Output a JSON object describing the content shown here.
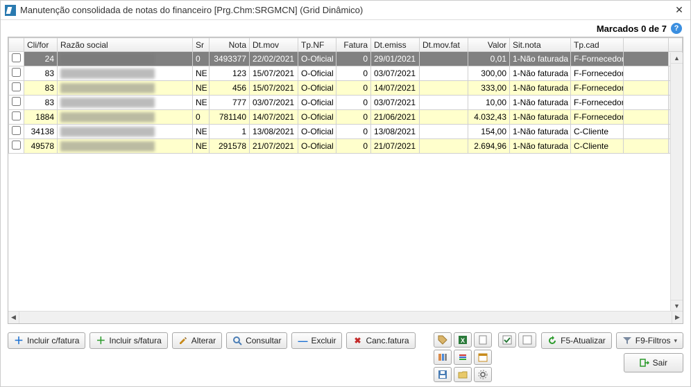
{
  "window": {
    "title": "Manutenção consolidada de notas do financeiro [Prg.Chm:SRGMCN] (Grid Dinâmico)"
  },
  "header": {
    "marcados_label": "Marcados 0 de 7"
  },
  "columns": {
    "chk": "",
    "clifor": "Cli/for",
    "razao": "Razão social",
    "sr": "Sr",
    "nota": "Nota",
    "dtmov": "Dt.mov",
    "tpnf": "Tp.NF",
    "fatura": "Fatura",
    "dtemiss": "Dt.emiss",
    "dtmovfat": "Dt.mov.fat",
    "valor": "Valor",
    "sitnota": "Sit.nota",
    "tpcad": "Tp.cad"
  },
  "rows": [
    {
      "clifor": "24",
      "razao": "████████████████",
      "sr": "0",
      "nota": "3493377",
      "dtmov": "22/02/2021",
      "tpnf": "O-Oficial",
      "fatura": "0",
      "dtemiss": "29/01/2021",
      "dtmovfat": "",
      "valor": "0,01",
      "sitnota": "1-Não faturada",
      "tpcad": "F-Fornecedor",
      "style": "sel"
    },
    {
      "clifor": "83",
      "razao": "████████████████",
      "sr": "NE",
      "nota": "123",
      "dtmov": "15/07/2021",
      "tpnf": "O-Oficial",
      "fatura": "0",
      "dtemiss": "03/07/2021",
      "dtmovfat": "",
      "valor": "300,00",
      "sitnota": "1-Não faturada",
      "tpcad": "F-Fornecedor",
      "style": "nor"
    },
    {
      "clifor": "83",
      "razao": "████████████████",
      "sr": "NE",
      "nota": "456",
      "dtmov": "15/07/2021",
      "tpnf": "O-Oficial",
      "fatura": "0",
      "dtemiss": "14/07/2021",
      "dtmovfat": "",
      "valor": "333,00",
      "sitnota": "1-Não faturada",
      "tpcad": "F-Fornecedor",
      "style": "yel"
    },
    {
      "clifor": "83",
      "razao": "████████████████",
      "sr": "NE",
      "nota": "777",
      "dtmov": "03/07/2021",
      "tpnf": "O-Oficial",
      "fatura": "0",
      "dtemiss": "03/07/2021",
      "dtmovfat": "",
      "valor": "10,00",
      "sitnota": "1-Não faturada",
      "tpcad": "F-Fornecedor",
      "style": "nor"
    },
    {
      "clifor": "1884",
      "razao": "████████████████",
      "sr": "0",
      "nota": "781140",
      "dtmov": "14/07/2021",
      "tpnf": "O-Oficial",
      "fatura": "0",
      "dtemiss": "21/06/2021",
      "dtmovfat": "",
      "valor": "4.032,43",
      "sitnota": "1-Não faturada",
      "tpcad": "F-Fornecedor",
      "style": "yel"
    },
    {
      "clifor": "34138",
      "razao": "████████████████",
      "sr": "NE",
      "nota": "1",
      "dtmov": "13/08/2021",
      "tpnf": "O-Oficial",
      "fatura": "0",
      "dtemiss": "13/08/2021",
      "dtmovfat": "",
      "valor": "154,00",
      "sitnota": "1-Não faturada",
      "tpcad": "C-Cliente",
      "style": "nor"
    },
    {
      "clifor": "49578",
      "razao": "████████████████",
      "sr": "NE",
      "nota": "291578",
      "dtmov": "21/07/2021",
      "tpnf": "O-Oficial",
      "fatura": "0",
      "dtemiss": "21/07/2021",
      "dtmovfat": "",
      "valor": "2.694,96",
      "sitnota": "1-Não faturada",
      "tpcad": "C-Cliente",
      "style": "yel"
    }
  ],
  "toolbar": {
    "incluir_c": "Incluir c/fatura",
    "incluir_s": "Incluir s/fatura",
    "alterar": "Alterar",
    "consultar": "Consultar",
    "excluir": "Excluir",
    "canc_fatura": "Canc.fatura",
    "atualizar": "F5-Atualizar",
    "filtros": "F9-Filtros",
    "sair": "Sair"
  }
}
